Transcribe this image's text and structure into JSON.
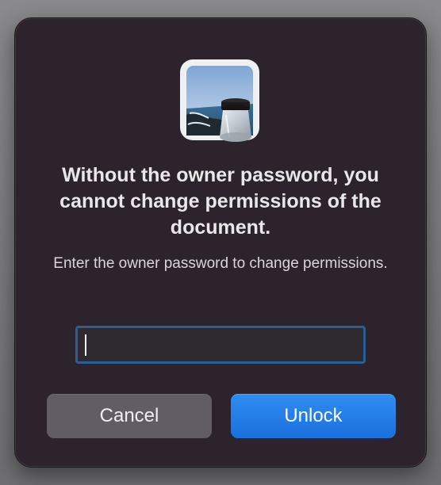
{
  "dialog": {
    "app_icon": "preview-app-icon",
    "title": "Without the owner password, you cannot change permissions of the document.",
    "message": "Enter the owner password to change permissions.",
    "password": {
      "value": "",
      "placeholder": ""
    },
    "buttons": {
      "cancel_label": "Cancel",
      "unlock_label": "Unlock"
    }
  },
  "colors": {
    "dialog_background": "#2c232c",
    "focus_ring": "#2a5e97",
    "primary_button": "#1f7be6",
    "secondary_button": "#625d64"
  }
}
